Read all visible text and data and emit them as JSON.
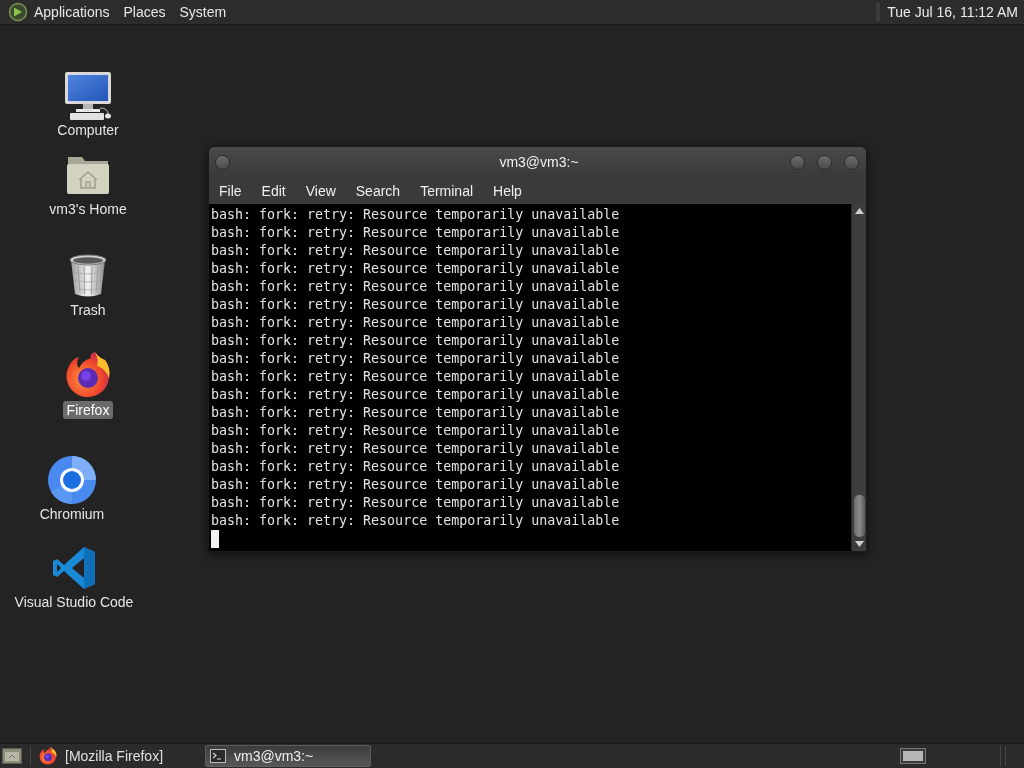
{
  "top_panel": {
    "menus": [
      "Applications",
      "Places",
      "System"
    ],
    "clock": "Tue Jul 16, 11:12 AM"
  },
  "desktop_icons": [
    {
      "label": "Computer",
      "kind": "computer",
      "selected": false
    },
    {
      "label": "vm3's Home",
      "kind": "home",
      "selected": false
    },
    {
      "label": "Trash",
      "kind": "trash",
      "selected": false
    },
    {
      "label": "Firefox",
      "kind": "firefox",
      "selected": true
    },
    {
      "label": "Chromium",
      "kind": "chromium",
      "selected": false
    },
    {
      "label": "Visual Studio Code",
      "kind": "vscode",
      "selected": false
    }
  ],
  "terminal": {
    "title": "vm3@vm3:~",
    "menus": [
      "File",
      "Edit",
      "View",
      "Search",
      "Terminal",
      "Help"
    ],
    "lines": [
      "bash: fork: retry: Resource temporarily unavailable",
      "bash: fork: retry: Resource temporarily unavailable",
      "bash: fork: retry: Resource temporarily unavailable",
      "bash: fork: retry: Resource temporarily unavailable",
      "bash: fork: retry: Resource temporarily unavailable",
      "bash: fork: retry: Resource temporarily unavailable",
      "bash: fork: retry: Resource temporarily unavailable",
      "bash: fork: retry: Resource temporarily unavailable",
      "bash: fork: retry: Resource temporarily unavailable",
      "bash: fork: retry: Resource temporarily unavailable",
      "bash: fork: retry: Resource temporarily unavailable",
      "bash: fork: retry: Resource temporarily unavailable",
      "bash: fork: retry: Resource temporarily unavailable",
      "bash: fork: retry: Resource temporarily unavailable",
      "bash: fork: retry: Resource temporarily unavailable",
      "bash: fork: retry: Resource temporarily unavailable",
      "bash: fork: retry: Resource temporarily unavailable",
      "bash: fork: retry: Resource temporarily unavailable"
    ]
  },
  "taskbar": {
    "items": [
      {
        "label": "[Mozilla Firefox]",
        "kind": "firefox",
        "selected": false
      },
      {
        "label": "vm3@vm3:~",
        "kind": "terminal",
        "selected": true
      }
    ]
  }
}
